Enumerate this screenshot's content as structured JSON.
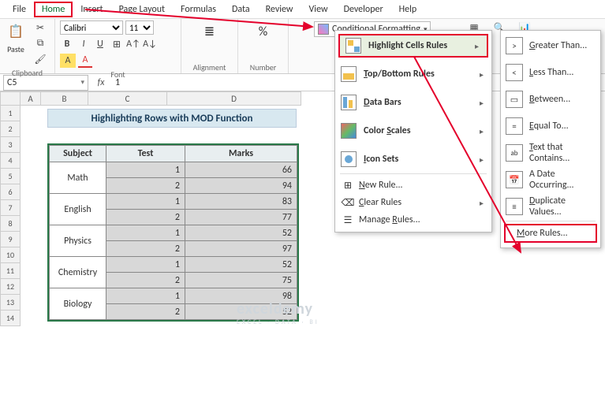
{
  "menu": {
    "file": "File",
    "home": "Home",
    "insert": "Insert",
    "page_layout": "Page Layout",
    "formulas": "Formulas",
    "data": "Data",
    "review": "Review",
    "view": "View",
    "developer": "Developer",
    "help": "Help"
  },
  "ribbon": {
    "clipboard": {
      "label": "Clipboard",
      "paste": "Paste"
    },
    "font": {
      "label": "Font",
      "family": "Calibri",
      "size": "11"
    },
    "alignment": {
      "label": "Alignment"
    },
    "number": {
      "label": "Number"
    },
    "cond_fmt": "Conditional Formatting"
  },
  "fbar": {
    "name": "C5",
    "fx": "fx",
    "value": "1"
  },
  "cols": [
    "A",
    "B",
    "C",
    "D"
  ],
  "rows": [
    "1",
    "2",
    "3",
    "4",
    "5",
    "6",
    "7",
    "8",
    "9",
    "10",
    "11",
    "12",
    "13",
    "14"
  ],
  "title": "Highlighting Rows with MOD Function",
  "table": {
    "headers": {
      "subject": "Subject",
      "test": "Test",
      "marks": "Marks"
    },
    "data": [
      {
        "subject": "Math",
        "test": "1",
        "marks": "66"
      },
      {
        "subject": "",
        "test": "2",
        "marks": "94"
      },
      {
        "subject": "English",
        "test": "1",
        "marks": "83"
      },
      {
        "subject": "",
        "test": "2",
        "marks": "77"
      },
      {
        "subject": "Physics",
        "test": "1",
        "marks": "52"
      },
      {
        "subject": "",
        "test": "2",
        "marks": "97"
      },
      {
        "subject": "Chemistry",
        "test": "1",
        "marks": "52"
      },
      {
        "subject": "",
        "test": "2",
        "marks": "75"
      },
      {
        "subject": "Biology",
        "test": "1",
        "marks": "98"
      },
      {
        "subject": "",
        "test": "2",
        "marks": "52"
      }
    ]
  },
  "cf_menu": {
    "highlight": "Highlight Cells Rules",
    "topbottom": "Top/Bottom Rules",
    "databars": "Data Bars",
    "colorscales": "Color Scales",
    "iconsets": "Icon Sets",
    "newrule": "New Rule...",
    "clear": "Clear Rules",
    "manage": "Manage Rules..."
  },
  "hcr_menu": {
    "gt": "Greater Than...",
    "lt": "Less Than...",
    "between": "Between...",
    "eq": "Equal To...",
    "text": "Text that Contains...",
    "date": "A Date Occurring...",
    "dup": "Duplicate Values...",
    "more": "More Rules..."
  },
  "watermark": {
    "name": "exceldemy",
    "tag": "EXCEL · DATA · BI"
  }
}
